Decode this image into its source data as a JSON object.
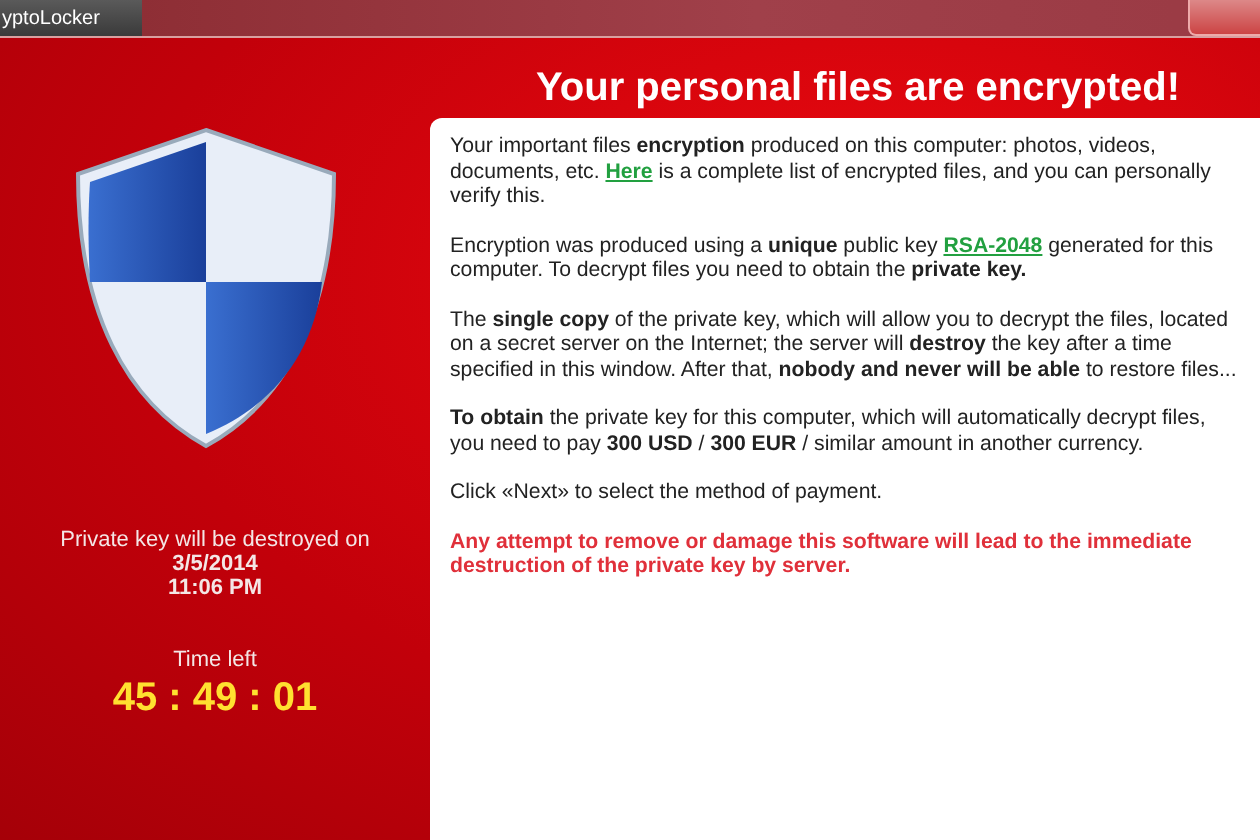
{
  "window": {
    "title": "yptoLocker"
  },
  "heading": "Your personal files are encrypted!",
  "deadline": {
    "label": "Private key will be destroyed on",
    "date": "3/5/2014",
    "time": "11:06 PM"
  },
  "countdown": {
    "label": "Time left",
    "value": "45 : 49 : 01"
  },
  "paragraphs": [
    {
      "kind": "normal",
      "parts": [
        {
          "kind": "text",
          "text": "Your important files **encryption** produced on this computer: photos, videos, documents, etc. "
        },
        {
          "kind": "link",
          "text": "Here"
        },
        {
          "kind": "text",
          "text": " is a complete list of encrypted files, and you can personally verify this."
        }
      ]
    },
    {
      "kind": "normal",
      "parts": [
        {
          "kind": "text",
          "text": "Encryption was produced using a **unique** public key "
        },
        {
          "kind": "link",
          "text": "RSA-2048"
        },
        {
          "kind": "text",
          "text": " generated for this computer. To decrypt files you need to obtain the **private key.**"
        }
      ]
    },
    {
      "kind": "normal",
      "parts": [
        {
          "kind": "text",
          "text": "The **single copy** of the private key, which will allow you to decrypt the files, located on a secret server on the Internet; the server will **destroy** the key after a time specified in this window. After that, **nobody and never will be able** to restore files..."
        }
      ]
    },
    {
      "kind": "normal",
      "parts": [
        {
          "kind": "text",
          "text": "**To obtain** the private key for this computer, which will automatically decrypt files, you need to pay **300 USD** / **300 EUR** / similar amount in another currency."
        }
      ]
    },
    {
      "kind": "normal",
      "parts": [
        {
          "kind": "text",
          "text": "Click «Next» to select the method of payment."
        }
      ]
    },
    {
      "kind": "warning",
      "parts": [
        {
          "kind": "text",
          "text": "Any attempt to remove or damage this software will lead to the immediate destruction of the private key by server."
        }
      ]
    }
  ]
}
